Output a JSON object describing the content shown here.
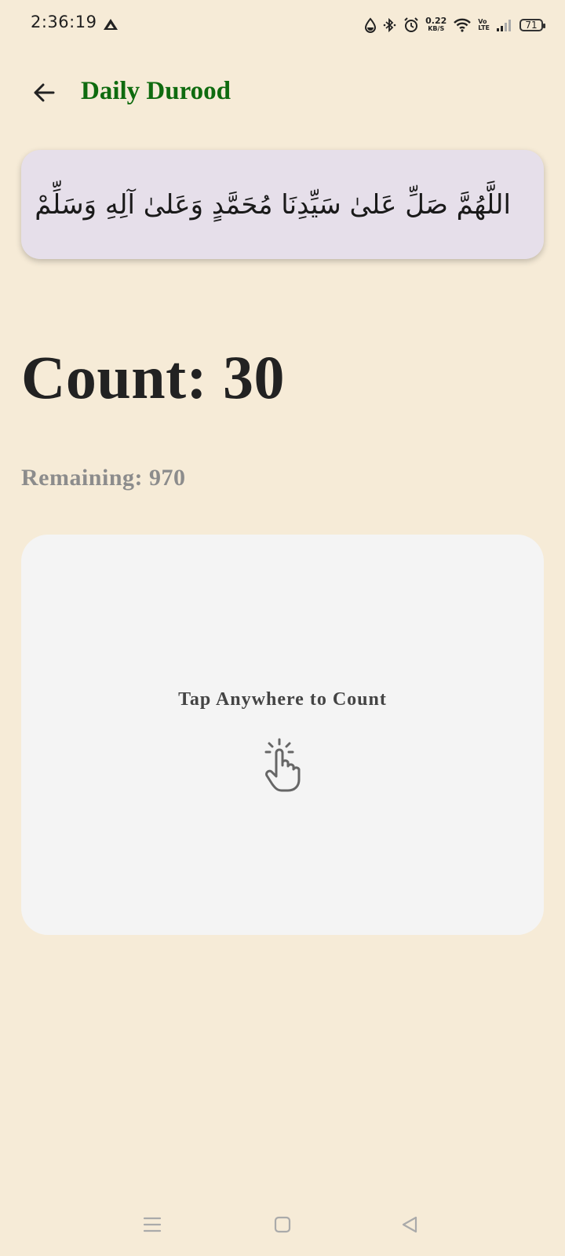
{
  "status_bar": {
    "time": "2:36:19",
    "net_speed_value": "0.22",
    "net_speed_unit": "KB/S",
    "volte_top": "Vo",
    "volte_bottom": "LTE",
    "battery": "71"
  },
  "app_bar": {
    "title": "Daily Durood",
    "back_icon": "arrow-left-icon"
  },
  "durood": {
    "text": "اللَّهُمَّ صَلِّ عَلىٰ سَيِّدِنَا مُحَمَّدٍ وَعَلىٰ آلِهِ وَسَلِّمْ"
  },
  "counter": {
    "count_label": "Count: 30",
    "remaining_label": "Remaining: 970",
    "count": 30,
    "remaining": 970
  },
  "tap_area": {
    "label": "Tap Anywhere to Count",
    "icon": "tap-hand-icon"
  },
  "colors": {
    "background": "#f6ebd7",
    "title": "#0f6b0f",
    "card": "#e6dfea",
    "tap_area": "#f4f4f4"
  },
  "nav": {
    "menu_icon": "menu-icon",
    "home_icon": "home-square-icon",
    "back_icon": "back-triangle-icon"
  }
}
